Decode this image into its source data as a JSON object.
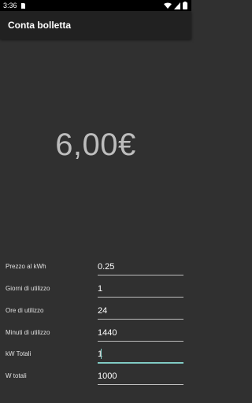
{
  "status_bar": {
    "time": "3:36",
    "icons": [
      "sd-card-icon",
      "wifi-icon",
      "signal-icon",
      "battery-icon"
    ]
  },
  "app_bar": {
    "title": "Conta bolletta"
  },
  "result": {
    "value": "6,00€"
  },
  "fields": [
    {
      "label": "Prezzo al kWh",
      "value": "0.25"
    },
    {
      "label": "Giorni di utilizzo",
      "value": "1"
    },
    {
      "label": "Ore di utilizzo",
      "value": "24"
    },
    {
      "label": "Minuti di utilizzo",
      "value": "1440"
    },
    {
      "label": "kW Totali",
      "value": "1"
    },
    {
      "label": "W totali",
      "value": "1000"
    }
  ],
  "colors": {
    "background": "#303030",
    "app_bar": "#212121",
    "accent": "#80cbc4",
    "result_text": "#bdbdbd"
  }
}
